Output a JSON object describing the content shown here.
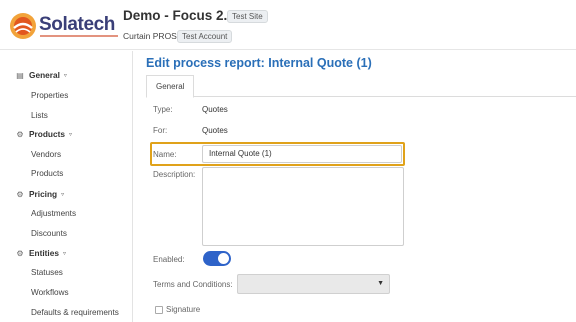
{
  "header": {
    "logo_text": "Solatech",
    "site_title": "Demo - Focus 2.0",
    "site_badge": "Test Site",
    "account_name": "Curtain PROS",
    "account_badge": "Test Account"
  },
  "sidebar": {
    "sections": [
      {
        "label": "General",
        "icon": "monitor-icon",
        "items": [
          "Properties",
          "Lists"
        ]
      },
      {
        "label": "Products",
        "icon": "gear-icon",
        "items": [
          "Vendors",
          "Products"
        ]
      },
      {
        "label": "Pricing",
        "icon": "gear-icon",
        "items": [
          "Adjustments",
          "Discounts"
        ]
      },
      {
        "label": "Entities",
        "icon": "gear-icon",
        "items": [
          "Statuses",
          "Workflows",
          "Defaults & requirements"
        ]
      }
    ]
  },
  "main": {
    "title": "Edit process report: Internal Quote (1)",
    "tabs": [
      {
        "label": "General"
      }
    ],
    "form": {
      "type_label": "Type:",
      "type_value": "Quotes",
      "for_label": "For:",
      "for_value": "Quotes",
      "name_label": "Name:",
      "name_value": "Internal Quote (1)",
      "description_label": "Description:",
      "description_value": "",
      "enabled_label": "Enabled:",
      "enabled": true,
      "terms_label": "Terms and Conditions:",
      "terms_value": "",
      "signature_label": "Signature",
      "signature_checked": false
    }
  },
  "colors": {
    "accent": "#2a6fb8",
    "highlight": "#e0a21a",
    "toggle_on": "#2e63c9",
    "logo_orange": "#e2571e",
    "logo_navy": "#3a3f78"
  }
}
